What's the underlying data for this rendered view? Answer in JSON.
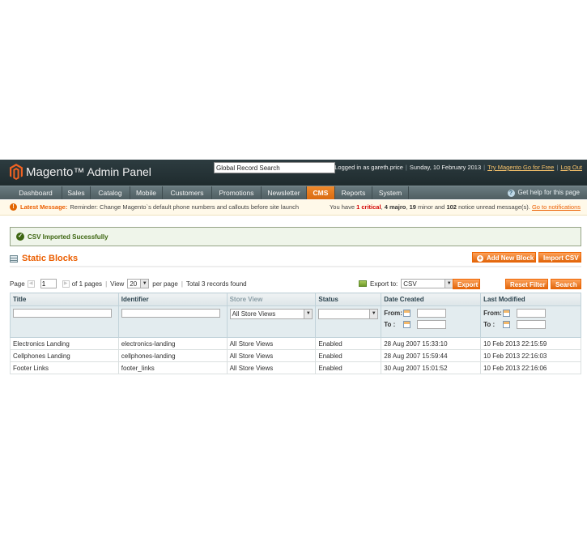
{
  "header": {
    "app_title_brand": "Magento",
    "app_title_suffix": "Admin Panel",
    "global_search_value": "Global Record Search",
    "logged_in": "Logged in as gareth.price",
    "date": "Sunday, 10 February 2013",
    "try_link": "Try Magento Go for Free",
    "logout": "Log Out"
  },
  "nav": {
    "items": [
      "Dashboard",
      "Sales",
      "Catalog",
      "Mobile",
      "Customers",
      "Promotions",
      "Newsletter",
      "CMS",
      "Reports",
      "System"
    ],
    "active": "CMS",
    "help": "Get help for this page"
  },
  "notice": {
    "label": "Latest Message:",
    "text": "Reminder: Change Magento`s default phone numbers and callouts before site launch",
    "you_have": "You have",
    "critical_count": "1 critical",
    "major_count": "4 majro",
    "minor_count": "19",
    "minor_text": "minor and",
    "notice_count": "102",
    "notice_text": "notice unread message(s).",
    "link": "Go to notifications"
  },
  "success_message": "CSV Imported Sucessfully",
  "page_title": "Static Blocks",
  "buttons": {
    "add_new": "Add New Block",
    "import_csv": "Import CSV",
    "export": "Export",
    "reset_filter": "Reset Filter",
    "search": "Search"
  },
  "pager": {
    "page_label": "Page",
    "page_value": "1",
    "of_pages": "of 1 pages",
    "view_label": "View",
    "per_page_value": "20",
    "per_page_label": "per page",
    "total": "Total 3 records found"
  },
  "export": {
    "label": "Export to:",
    "format": "CSV"
  },
  "table": {
    "columns": [
      "Title",
      "Identifier",
      "Store View",
      "Status",
      "Date Created",
      "Last Modified"
    ],
    "filter": {
      "store_view": "All Store Views",
      "from_label": "From:",
      "to_label": "To :"
    },
    "rows": [
      [
        "Electronics Landing",
        "electronics-landing",
        "All Store Views",
        "Enabled",
        "28 Aug 2007 15:33:10",
        "10 Feb 2013 22:15:59"
      ],
      [
        "Cellphones Landing",
        "cellphones-landing",
        "All Store Views",
        "Enabled",
        "28 Aug 2007 15:59:44",
        "10 Feb 2013 22:16:03"
      ],
      [
        "Footer Links",
        "footer_links",
        "All Store Views",
        "Enabled",
        "30 Aug 2007 15:01:52",
        "10 Feb 2013 22:16:06"
      ]
    ]
  },
  "colors": {
    "accent": "#eb5e00",
    "header_bg": "#2d3c40",
    "nav_bg": "#5b6b70",
    "success_text": "#3d6611"
  }
}
